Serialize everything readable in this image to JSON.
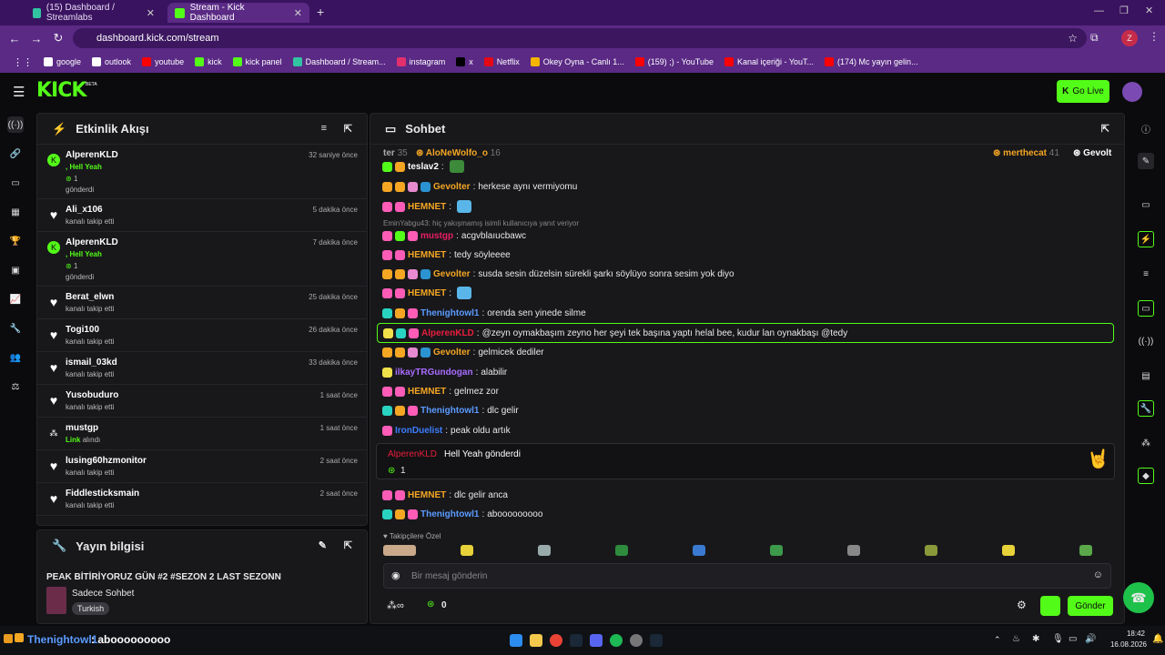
{
  "browser": {
    "tabs": [
      {
        "label": "(15) Dashboard / Streamlabs",
        "color": "#31c3a2"
      },
      {
        "label": "Stream - Kick Dashboard",
        "color": "#53fc18"
      }
    ],
    "url": "dashboard.kick.com/stream",
    "bookmarks": [
      {
        "label": "google",
        "color": "#ffffff"
      },
      {
        "label": "outlook",
        "color": "#ffffff"
      },
      {
        "label": "youtube",
        "color": "#ff0000"
      },
      {
        "label": "kick",
        "color": "#53fc18"
      },
      {
        "label": "kick panel",
        "color": "#53fc18"
      },
      {
        "label": "Dashboard / Stream...",
        "color": "#31c3a2"
      },
      {
        "label": "instagram",
        "color": "#e1306c"
      },
      {
        "label": "x",
        "color": "#000000"
      },
      {
        "label": "Netflix",
        "color": "#e50914"
      },
      {
        "label": "Okey Oyna - Canlı 1...",
        "color": "#f4b400"
      },
      {
        "label": "(159) ;) - YouTube",
        "color": "#ff0000"
      },
      {
        "label": "Kanal içeriği - YouT...",
        "color": "#ff0000"
      },
      {
        "label": "(174) Mc yayın gelin...",
        "color": "#ff0000"
      }
    ],
    "profile_letter": "Z"
  },
  "header": {
    "logo": "KICK",
    "beta": "BETA",
    "go_live": "Go Live"
  },
  "activity": {
    "title": "Etkinlik Akışı",
    "events": [
      {
        "name": "AlperenKLD",
        "time": "32 saniye önce",
        "type": "gift",
        "line1": ", Hell Yeah",
        "amount": "1",
        "line2": "gönderdi"
      },
      {
        "name": "Ali_x106",
        "time": "5 dakika önce",
        "type": "follow",
        "line1": "kanalı takip etti"
      },
      {
        "name": "AlperenKLD",
        "time": "7 dakika önce",
        "type": "gift",
        "line1": ", Hell Yeah",
        "amount": "1",
        "line2": "gönderdi"
      },
      {
        "name": "Berat_elwn",
        "time": "25 dakika önce",
        "type": "follow",
        "line1": "kanalı takip etti"
      },
      {
        "name": "Togi100",
        "time": "26 dakika önce",
        "type": "follow",
        "line1": "kanalı takip etti"
      },
      {
        "name": "ismail_03kd",
        "time": "33 dakika önce",
        "type": "follow",
        "line1": "kanalı takip etti"
      },
      {
        "name": "Yusobuduro",
        "time": "1 saat önce",
        "type": "follow",
        "line1": "kanalı takip etti"
      },
      {
        "name": "mustgp",
        "time": "1 saat önce",
        "type": "link",
        "line1": "Link",
        "line1b": "alındı"
      },
      {
        "name": "lusing60hzmonitor",
        "time": "2 saat önce",
        "type": "follow",
        "line1": "kanalı takip etti"
      },
      {
        "name": "Fiddlesticksmain",
        "time": "2 saat önce",
        "type": "follow",
        "line1": "kanalı takip etti"
      }
    ]
  },
  "stream_info": {
    "title": "Yayın bilgisi",
    "stream_title": "PEAK BİTİRİYORUZ GÜN #2 #SEZON 2 LAST SEZONN",
    "category": "Sadece Sohbet",
    "language": "Turkish"
  },
  "chat": {
    "title": "Sohbet",
    "top_gifters": [
      {
        "name": "ter",
        "count": "35"
      },
      {
        "name": "AloNeWolfo_o",
        "count": "16"
      },
      {
        "name": "merthecat",
        "count": "41"
      },
      {
        "name": "Gevolt",
        "count": ""
      }
    ],
    "reply_note": "EminYabgu43: hiç yakışmamış isimli kullanıcıya yanıt veriyor",
    "messages": [
      {
        "user": "teslav2",
        "color": "#ffffff",
        "text": "",
        "badges": [
          "#53fc18",
          "#f5a623"
        ]
      },
      {
        "user": "Gevolter",
        "color": "#f5a623",
        "text": "herkese aynı vermiyomu",
        "badges": [
          "#f5a623",
          "#f5a623",
          "#e88ad0",
          "#2b93d1"
        ]
      },
      {
        "user": "HEMNET",
        "color": "#f5a623",
        "text": "",
        "badges": [
          "#ff5cb8",
          "#ff5cb8"
        ]
      },
      {
        "user": "mustgp",
        "color": "#e91e63",
        "text": "acgvblaıucbawc",
        "badges": [
          "#ff5cb8",
          "#53fc18",
          "#ff5cb8"
        ]
      },
      {
        "user": "HEMNET",
        "color": "#f5a623",
        "text": "tedy söyleeee",
        "badges": [
          "#ff5cb8",
          "#ff5cb8"
        ]
      },
      {
        "user": "Gevolter",
        "color": "#f5a623",
        "text": "susda sesin düzelsin sürekli şarkı söylüyo sonra sesim yok diyo",
        "badges": [
          "#f5a623",
          "#f5a623",
          "#e88ad0",
          "#2b93d1"
        ]
      },
      {
        "user": "HEMNET",
        "color": "#f5a623",
        "text": "",
        "badges": [
          "#ff5cb8",
          "#ff5cb8"
        ]
      },
      {
        "user": "Thenightowl1",
        "color": "#5b9bff",
        "text": "orenda sen yinede silme",
        "badges": [
          "#29d3c2",
          "#f5a623",
          "#ff5cb8"
        ]
      },
      {
        "user": "AlperenKLD",
        "color": "#e91e3c",
        "text": "@zeyn oymakbaşım zeyno her şeyi tek başına yaptı helal bee, kudur lan oynakbaşı @tedy",
        "badges": [
          "#f0e04a",
          "#29d3c2",
          "#ff5cb8"
        ]
      },
      {
        "user": "Gevolter",
        "color": "#f5a623",
        "text": "gelmicek dediler",
        "badges": [
          "#f5a623",
          "#f5a623",
          "#e88ad0",
          "#2b93d1"
        ]
      },
      {
        "user": "ilkayTRGundogan",
        "color": "#a96cff",
        "text": "alabilir",
        "badges": [
          "#f0e04a"
        ]
      },
      {
        "user": "HEMNET",
        "color": "#f5a623",
        "text": "gelmez zor",
        "badges": [
          "#ff5cb8",
          "#ff5cb8"
        ]
      },
      {
        "user": "Thenightowl1",
        "color": "#5b9bff",
        "text": "dlc gelir",
        "badges": [
          "#29d3c2",
          "#f5a623",
          "#ff5cb8"
        ]
      },
      {
        "user": "IronDuelist",
        "color": "#3d7dff",
        "text": "peak oldu artık",
        "badges": [
          "#ff5cb8"
        ]
      }
    ],
    "gift_card": {
      "user": "AlperenKLD",
      "text": "Hell Yeah gönderdi",
      "amount": "1"
    },
    "messages_after": [
      {
        "user": "HEMNET",
        "color": "#f5a623",
        "text": "dlc gelir anca",
        "badges": [
          "#ff5cb8",
          "#ff5cb8"
        ]
      },
      {
        "user": "Thenightowl1",
        "color": "#5b9bff",
        "text": "abooooooooo",
        "badges": [
          "#29d3c2",
          "#f5a623",
          "#ff5cb8"
        ]
      }
    ],
    "followers_only_label": "Takipçilere Özel",
    "input_placeholder": "Bir mesaj gönderin",
    "points": "0",
    "send": "Gönder"
  },
  "taskbar": {
    "ticker_user": "Thenightowl1",
    "ticker_text": ": abooooooooo",
    "time": "18:42",
    "date": "16.08.2026"
  }
}
